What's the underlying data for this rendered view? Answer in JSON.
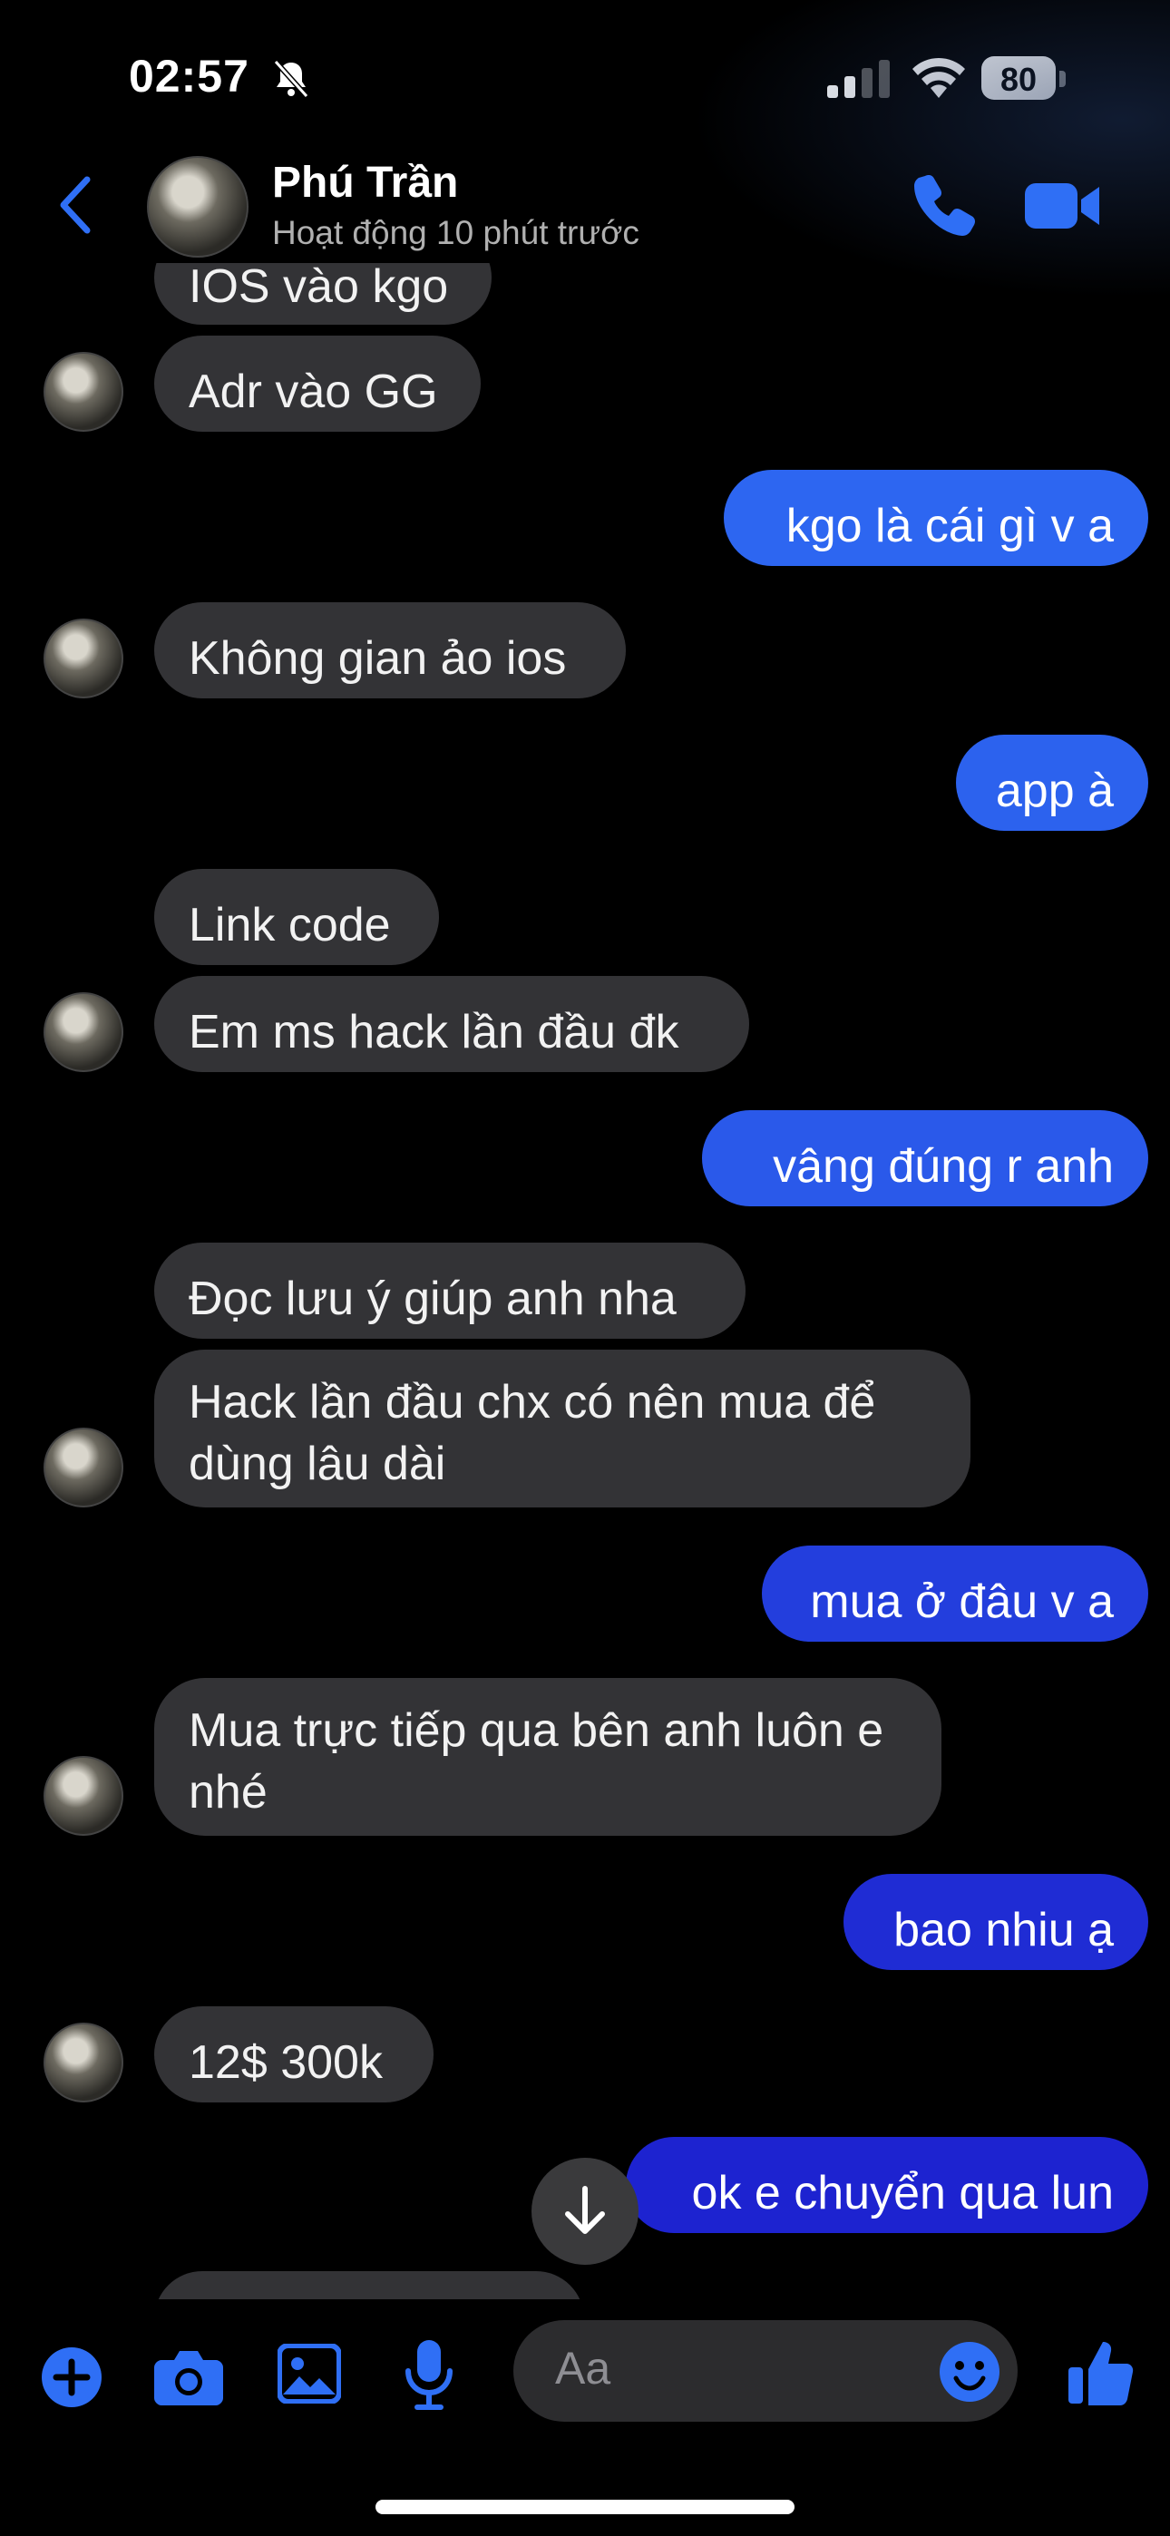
{
  "status_bar": {
    "time": "02:57",
    "battery": "80"
  },
  "header": {
    "name": "Phú Trần",
    "status": "Hoạt động 10 phút trước"
  },
  "messages": [
    {
      "from": "them",
      "text": "IOS vào kgo"
    },
    {
      "from": "them",
      "text": "Adr vào GG"
    },
    {
      "from": "me",
      "text": "kgo là cái gì v a"
    },
    {
      "from": "them",
      "text": "Không gian ảo ios"
    },
    {
      "from": "me",
      "text": "app à"
    },
    {
      "from": "them",
      "text": "Link code"
    },
    {
      "from": "them",
      "text": "Em ms hack lần đầu đk"
    },
    {
      "from": "me",
      "text": "vâng đúng r anh"
    },
    {
      "from": "them",
      "text": "Đọc lưu ý giúp anh nha"
    },
    {
      "from": "them",
      "text": "Hack lần đầu chx có nên mua để dùng lâu dài"
    },
    {
      "from": "me",
      "text": "mua ở đâu v a"
    },
    {
      "from": "them",
      "text": "Mua trực tiếp qua bên anh luôn e nhé"
    },
    {
      "from": "me",
      "text": "bao nhiu ạ"
    },
    {
      "from": "them",
      "text": "12$ 300k"
    },
    {
      "from": "me",
      "text": "ok e chuyển qua lun"
    }
  ],
  "composer": {
    "placeholder": "Aa"
  },
  "icons": {
    "plus": "plus-icon",
    "camera": "camera-icon",
    "gallery": "image-icon",
    "mic": "microphone-icon",
    "emoji": "emoji-icon",
    "like": "thumbs-up-icon",
    "call": "phone-icon",
    "video": "video-icon",
    "back": "chevron-left-icon",
    "scroll": "arrow-down-icon"
  },
  "colors": {
    "accent": "#2f6ff5",
    "received_bubble": "#333336",
    "sent_top": "#2f6ff5",
    "sent_bottom": "#1a16c9"
  }
}
